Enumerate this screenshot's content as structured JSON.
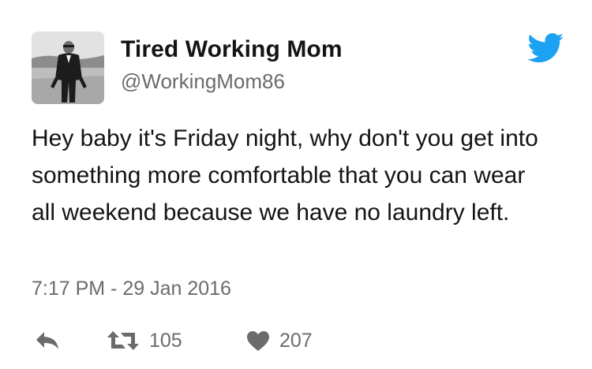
{
  "tweet": {
    "author": {
      "name": "Tired Working Mom",
      "handle": "@WorkingMom86"
    },
    "text": "Hey baby it's Friday night, why don't you get into something more comfortable that you can wear all weekend because we have no laundry left.",
    "timestamp": "7:17 PM - 29 Jan 2016",
    "actions": {
      "reply": {
        "icon": "reply-icon"
      },
      "retweet": {
        "icon": "retweet-icon",
        "count": "105"
      },
      "like": {
        "icon": "heart-icon",
        "count": "207"
      }
    }
  },
  "brand": {
    "logo_icon": "twitter-bird-icon",
    "logo_color": "#1DA1F2",
    "icon_color": "#6b6b6b"
  }
}
